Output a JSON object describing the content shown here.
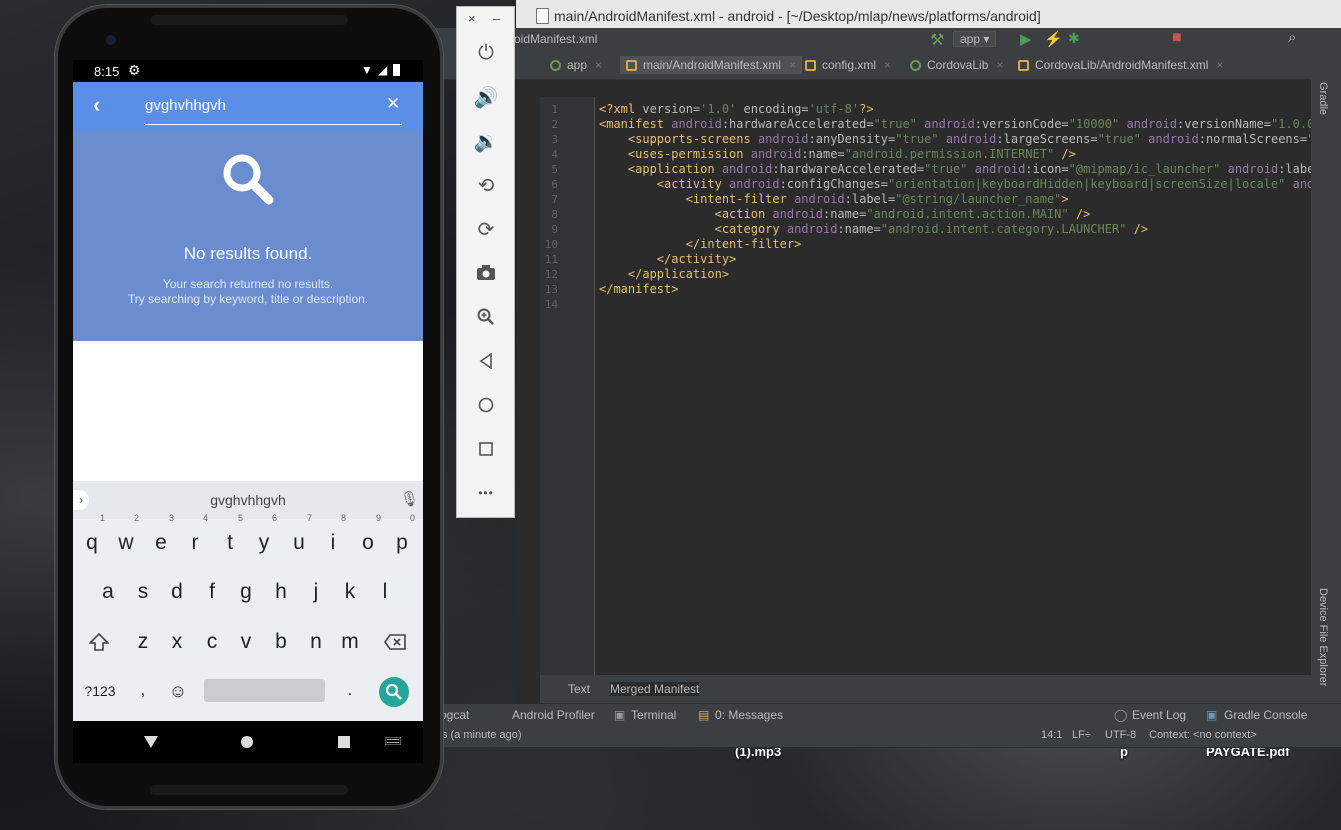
{
  "desktop": {
    "files": [
      "(1).mp3",
      "p",
      "PAYGATE.pdf"
    ]
  },
  "ide": {
    "window_title": "main/AndroidManifest.xml - android - [~/Desktop/mlap/news/platforms/android]",
    "breadcrumb": "roidManifest.xml",
    "run_config": "app",
    "tabs": [
      "app",
      "main/AndroidManifest.xml",
      "config.xml",
      "CordovaLib",
      "CordovaLib/AndroidManifest.xml"
    ],
    "code_lines": [
      "1",
      "2",
      "3",
      "4",
      "5",
      "6",
      "7",
      "8",
      "9",
      "10",
      "11",
      "12",
      "13",
      "14"
    ],
    "bottom_tabs": [
      "Text",
      "Merged Manifest"
    ],
    "tool_windows": [
      "ogcat",
      "Android Profiler",
      "Terminal",
      "0: Messages",
      "Event Log",
      "Gradle Console"
    ],
    "status": {
      "message": "s (a minute ago)",
      "position": "14:1",
      "line_sep": "LF÷",
      "encoding": "UTF-8",
      "context": "Context: <no context>"
    },
    "right_strip": [
      "Gradle",
      "Device File Explorer"
    ]
  },
  "emulator_panel": {
    "close": "×",
    "minimize": "–",
    "more": "•••"
  },
  "phone": {
    "time": "8:15",
    "search_value": "gvghvhhgvh",
    "empty_title": "No results found.",
    "empty_line1": "Your search returned no results.",
    "empty_line2": "Try searching by keyword, title or description.",
    "suggestion": "gvghvhhgvh",
    "keyboard_row1": [
      "q",
      "w",
      "e",
      "r",
      "t",
      "y",
      "u",
      "i",
      "o",
      "p"
    ],
    "keyboard_row1_hints": [
      "1",
      "2",
      "3",
      "4",
      "5",
      "6",
      "7",
      "8",
      "9",
      "0"
    ],
    "keyboard_row2": [
      "a",
      "s",
      "d",
      "f",
      "g",
      "h",
      "j",
      "k",
      "l"
    ],
    "keyboard_row3": [
      "z",
      "x",
      "c",
      "v",
      "b",
      "n",
      "m"
    ],
    "key_symbols": "?123",
    "key_comma": ",",
    "key_period": "."
  },
  "colors": {
    "appbar": "#5b8ee6",
    "results_bg": "#6a8dd0",
    "search_fab": "#26a69a"
  }
}
